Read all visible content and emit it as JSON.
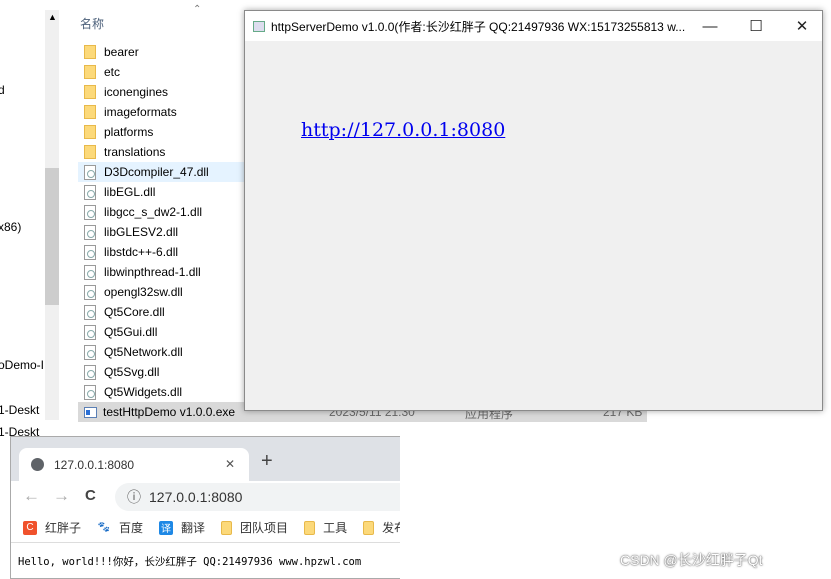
{
  "explorer": {
    "nav_fragments": [
      "d",
      "x86)",
      "oDemo-I",
      "1-Deskt",
      "1-Deskt"
    ],
    "column_header": "名称",
    "items": [
      {
        "name": "bearer",
        "type": "folder"
      },
      {
        "name": "etc",
        "type": "folder"
      },
      {
        "name": "iconengines",
        "type": "folder"
      },
      {
        "name": "imageformats",
        "type": "folder"
      },
      {
        "name": "platforms",
        "type": "folder"
      },
      {
        "name": "translations",
        "type": "folder"
      },
      {
        "name": "D3Dcompiler_47.dll",
        "type": "dll"
      },
      {
        "name": "libEGL.dll",
        "type": "dll"
      },
      {
        "name": "libgcc_s_dw2-1.dll",
        "type": "dll"
      },
      {
        "name": "libGLESV2.dll",
        "type": "dll"
      },
      {
        "name": "libstdc++-6.dll",
        "type": "dll"
      },
      {
        "name": "libwinpthread-1.dll",
        "type": "dll"
      },
      {
        "name": "opengl32sw.dll",
        "type": "dll"
      },
      {
        "name": "Qt5Core.dll",
        "type": "dll"
      },
      {
        "name": "Qt5Gui.dll",
        "type": "dll"
      },
      {
        "name": "Qt5Network.dll",
        "type": "dll"
      },
      {
        "name": "Qt5Svg.dll",
        "type": "dll"
      },
      {
        "name": "Qt5Widgets.dll",
        "type": "dll"
      }
    ],
    "selected": {
      "name": "testHttpDemo v1.0.0.exe",
      "date": "2023/5/11 21:30",
      "type": "应用程序",
      "size": "217 KB"
    }
  },
  "qt_window": {
    "title": "httpServerDemo v1.0.0(作者:长沙红胖子 QQ:21497936 WX:15173255813 w...",
    "minimize": "—",
    "maximize": "☐",
    "close": "✕",
    "link": "http://127.0.0.1:8080"
  },
  "browser": {
    "tab_title": "127.0.0.1:8080",
    "tab_close": "✕",
    "new_tab": "+",
    "back": "←",
    "forward": "→",
    "reload": "C",
    "info": "ⓘ",
    "address": "127.0.0.1:8080",
    "bookmarks": [
      {
        "label": "红胖子",
        "icon": "csdn-icon",
        "color": "#f0522c",
        "glyph": "C"
      },
      {
        "label": "百度",
        "icon": "baidu-paw-icon",
        "color": "#2932e1",
        "glyph": "🐾"
      },
      {
        "label": "翻译",
        "icon": "translate-icon",
        "color": "#1e88e5",
        "glyph": "译"
      },
      {
        "label": "团队项目",
        "icon": "folder-icon",
        "color": "#fcd97a",
        "glyph": ""
      },
      {
        "label": "工具",
        "icon": "folder-icon",
        "color": "#fcd97a",
        "glyph": ""
      },
      {
        "label": "发布",
        "icon": "folder-icon",
        "color": "#fcd97a",
        "glyph": ""
      }
    ],
    "content": "Hello, world!!!你好，长沙红胖子 QQ:21497936 www.hpzwl.com"
  },
  "watermark": "CSDN @长沙红胖子Qt"
}
